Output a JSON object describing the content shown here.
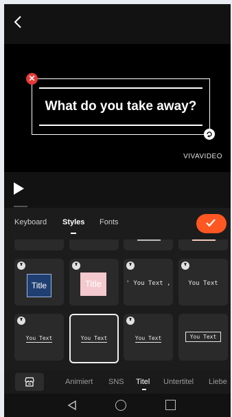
{
  "preview": {
    "caption": "What do you take away?",
    "watermark": "VIVAVIDEO"
  },
  "panel": {
    "tabs": [
      {
        "label": "Keyboard"
      },
      {
        "label": "Styles"
      },
      {
        "label": "Fonts"
      }
    ],
    "active_tab": "Styles"
  },
  "tiles": {
    "title_blue": "Title",
    "title_pink": "Title",
    "sample_1": "' You Text ,",
    "sample_2": "You Text",
    "sample_3": "You Text",
    "sample_4": "You Text",
    "sample_5": "You Text",
    "sample_6": "You Text"
  },
  "categories": [
    {
      "label": "Animiert"
    },
    {
      "label": "SNS"
    },
    {
      "label": "Titel"
    },
    {
      "label": "Untertitel"
    },
    {
      "label": "Liebe"
    }
  ],
  "active_category": "Titel",
  "colors": {
    "accent": "#ff5722",
    "delete": "#e53935"
  },
  "icons": {
    "back": "chevron-left-icon",
    "confirm": "checkmark-icon",
    "store": "store-icon",
    "play": "play-icon"
  }
}
